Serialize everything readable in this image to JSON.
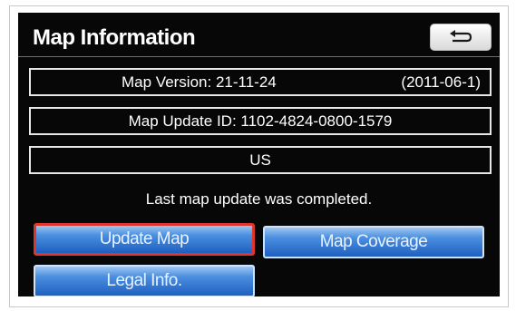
{
  "header": {
    "title": "Map Information",
    "back_icon": "return-arrow-icon"
  },
  "info": {
    "map_version_label": "Map Version: 21-11-24",
    "map_version_date": "(2011-06-1)",
    "map_update_id": "Map Update ID: 1102-4824-0800-1579",
    "region": "US"
  },
  "status": {
    "message": "Last map update was completed."
  },
  "buttons": {
    "update_map": "Update Map",
    "map_coverage": "Map Coverage",
    "legal_info": "Legal Info."
  },
  "colors": {
    "screen_background": "#070707",
    "button_blue": "#1f5fbf",
    "selected_border": "#e0352b"
  }
}
